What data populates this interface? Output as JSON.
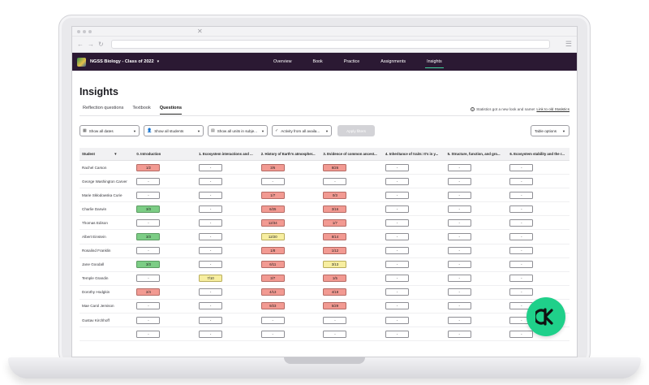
{
  "nav": {
    "class_name": "NGSS Biology - Class of 2022",
    "links": [
      "Overview",
      "Book",
      "Practice",
      "Assignments",
      "Insights"
    ],
    "active": "Insights"
  },
  "page": {
    "title": "Insights",
    "tabs": [
      "Reflection questions",
      "Textbook",
      "Questions"
    ],
    "active_tab": "Questions",
    "notice_text": "Statistics got a new look and name!",
    "notice_link": "Link to old Statistics"
  },
  "filters": {
    "dates": "Show all dates",
    "students": "Show all students",
    "units": "Show all units in subje...",
    "activity": "Activity from all availa...",
    "apply": "Apply filters",
    "table_options": "Table options"
  },
  "table": {
    "headers": [
      "Student",
      "0. Introduction",
      "1. Ecosystem interactions and ...",
      "2. History of Earth's atmospher...",
      "3. Evidence of common ancest...",
      "4. Inheritance of traits: It's in y...",
      "5. Structure, function, and gro...",
      "6. Ecosystem stability and the r..."
    ],
    "sort_icon": "sort-arrow-icon",
    "rows": [
      {
        "name": "Rachel Carson",
        "cells": [
          "1/2",
          "-",
          "3/6",
          "8/26",
          "-",
          "-",
          "-"
        ]
      },
      {
        "name": "George Washington Carver",
        "cells": [
          "-",
          "-",
          "-",
          "-",
          "-",
          "-",
          "-"
        ]
      },
      {
        "name": "Marie Skłodowska Curie",
        "cells": [
          "-",
          "-",
          "1/7",
          "0/3",
          "-",
          "-",
          "-"
        ]
      },
      {
        "name": "Charlie Darwin",
        "cells": [
          "3/3",
          "-",
          "6/25",
          "3/16",
          "-",
          "-",
          "-"
        ]
      },
      {
        "name": "Thomas Edison",
        "cells": [
          "-",
          "-",
          "12/34",
          "1/7",
          "-",
          "-",
          "-"
        ]
      },
      {
        "name": "Albert Einstein",
        "cells": [
          "3/3",
          "-",
          "12/20",
          "8/14",
          "-",
          "-",
          "-"
        ]
      },
      {
        "name": "Rosalind Franklin",
        "cells": [
          "-",
          "-",
          "1/8",
          "1/12",
          "-",
          "-",
          "-"
        ]
      },
      {
        "name": "Jane Goodall",
        "cells": [
          "3/3",
          "-",
          "6/11",
          "3/13",
          "-",
          "-",
          "-"
        ]
      },
      {
        "name": "Temple Grandin",
        "cells": [
          "-",
          "7/10",
          "3/7",
          "1/5",
          "-",
          "-",
          "-"
        ]
      },
      {
        "name": "Dorothy Hodgkin",
        "cells": [
          "2/4",
          "-",
          "4/13",
          "4/18",
          "-",
          "-",
          "-"
        ]
      },
      {
        "name": "Mae Carol Jemison",
        "cells": [
          "-",
          "-",
          "9/23",
          "5/29",
          "-",
          "-",
          "-"
        ]
      },
      {
        "name": "Gustav Kirchhoff",
        "cells": [
          "-",
          "-",
          "-",
          "-",
          "-",
          "-",
          "-"
        ]
      },
      {
        "name": "",
        "cells": [
          "-",
          "-",
          "-",
          "-",
          "-",
          "-",
          "-"
        ]
      }
    ],
    "cell_colors": {
      "red": "#f29a92",
      "green": "#7ccd85",
      "yellow": "#f7eea0"
    }
  },
  "fab_icon": "brand-logo-icon",
  "colors": {
    "nav_bg": "#2b1933",
    "accent": "#3fd39a",
    "fab": "#1fd08a"
  }
}
